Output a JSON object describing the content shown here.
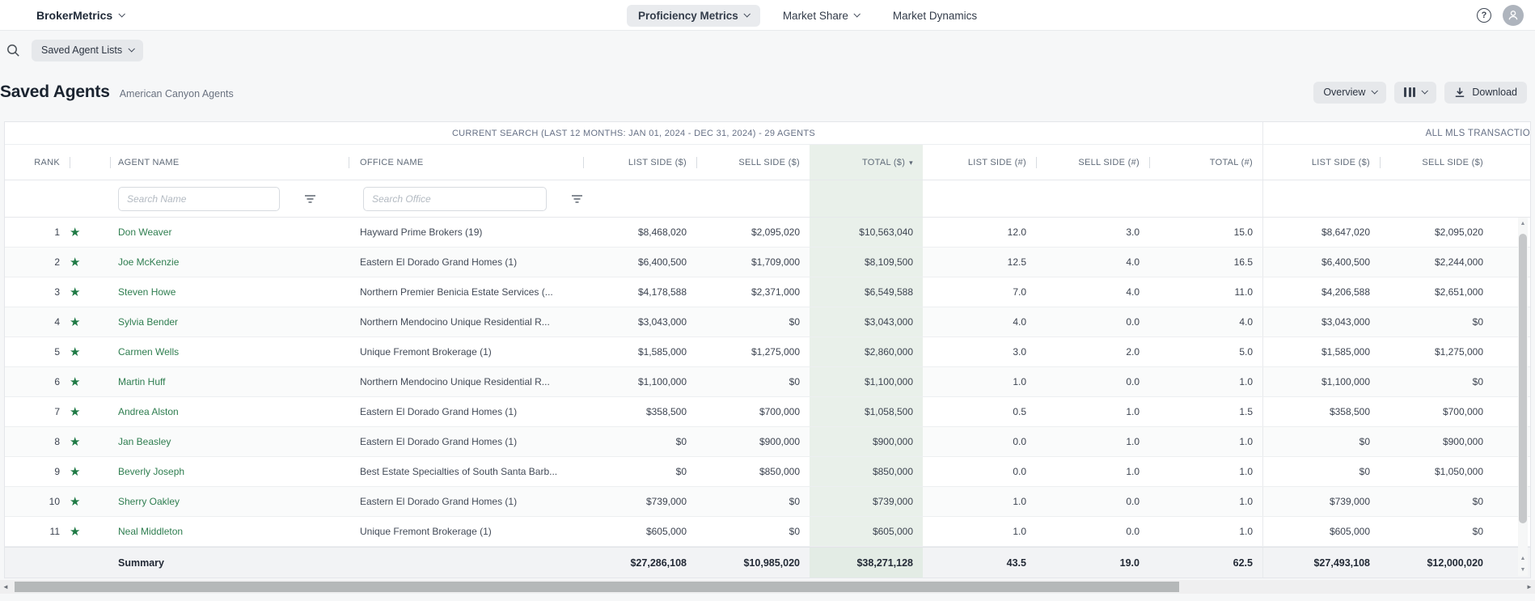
{
  "topnav": {
    "brand": "BrokerMetrics",
    "items": [
      {
        "label": "Proficiency Metrics"
      },
      {
        "label": "Market Share"
      },
      {
        "label": "Market Dynamics"
      }
    ]
  },
  "toolbar": {
    "saved_lists": "Saved Agent Lists"
  },
  "header": {
    "title": "Saved Agents",
    "subtitle": "American Canyon Agents",
    "overview": "Overview",
    "download": "Download"
  },
  "table": {
    "group_left": "CURRENT SEARCH (LAST 12 MONTHS: JAN 01, 2024 - DEC 31, 2024) - 29 AGENTS",
    "group_right": "ALL MLS TRANSACTIO",
    "columns": {
      "rank": "RANK",
      "agent": "AGENT NAME",
      "office": "OFFICE NAME",
      "list_amt": "LIST SIDE ($)",
      "sell_amt": "SELL SIDE ($)",
      "total_amt": "TOTAL ($)",
      "list_cnt": "LIST SIDE (#)",
      "sell_cnt": "SELL SIDE (#)",
      "total_cnt": "TOTAL (#)",
      "mls_list_amt": "LIST SIDE ($)",
      "mls_sell_amt": "SELL SIDE ($)"
    },
    "filters": {
      "name_placeholder": "Search Name",
      "office_placeholder": "Search Office"
    },
    "rows": [
      {
        "rank": "1",
        "name": "Don Weaver",
        "office": "Hayward Prime Brokers (19)",
        "list_amt": "$8,468,020",
        "sell_amt": "$2,095,020",
        "total_amt": "$10,563,040",
        "list_cnt": "12.0",
        "sell_cnt": "3.0",
        "total_cnt": "15.0",
        "mls_list_amt": "$8,647,020",
        "mls_sell_amt": "$2,095,020"
      },
      {
        "rank": "2",
        "name": "Joe McKenzie",
        "office": "Eastern El Dorado Grand Homes (1)",
        "list_amt": "$6,400,500",
        "sell_amt": "$1,709,000",
        "total_amt": "$8,109,500",
        "list_cnt": "12.5",
        "sell_cnt": "4.0",
        "total_cnt": "16.5",
        "mls_list_amt": "$6,400,500",
        "mls_sell_amt": "$2,244,000"
      },
      {
        "rank": "3",
        "name": "Steven Howe",
        "office": "Northern Premier Benicia Estate Services (...",
        "list_amt": "$4,178,588",
        "sell_amt": "$2,371,000",
        "total_amt": "$6,549,588",
        "list_cnt": "7.0",
        "sell_cnt": "4.0",
        "total_cnt": "11.0",
        "mls_list_amt": "$4,206,588",
        "mls_sell_amt": "$2,651,000"
      },
      {
        "rank": "4",
        "name": "Sylvia Bender",
        "office": "Northern Mendocino Unique Residential R...",
        "list_amt": "$3,043,000",
        "sell_amt": "$0",
        "total_amt": "$3,043,000",
        "list_cnt": "4.0",
        "sell_cnt": "0.0",
        "total_cnt": "4.0",
        "mls_list_amt": "$3,043,000",
        "mls_sell_amt": "$0"
      },
      {
        "rank": "5",
        "name": "Carmen Wells",
        "office": "Unique Fremont Brokerage (1)",
        "list_amt": "$1,585,000",
        "sell_amt": "$1,275,000",
        "total_amt": "$2,860,000",
        "list_cnt": "3.0",
        "sell_cnt": "2.0",
        "total_cnt": "5.0",
        "mls_list_amt": "$1,585,000",
        "mls_sell_amt": "$1,275,000"
      },
      {
        "rank": "6",
        "name": "Martin Huff",
        "office": "Northern Mendocino Unique Residential R...",
        "list_amt": "$1,100,000",
        "sell_amt": "$0",
        "total_amt": "$1,100,000",
        "list_cnt": "1.0",
        "sell_cnt": "0.0",
        "total_cnt": "1.0",
        "mls_list_amt": "$1,100,000",
        "mls_sell_amt": "$0"
      },
      {
        "rank": "7",
        "name": "Andrea Alston",
        "office": "Eastern El Dorado Grand Homes (1)",
        "list_amt": "$358,500",
        "sell_amt": "$700,000",
        "total_amt": "$1,058,500",
        "list_cnt": "0.5",
        "sell_cnt": "1.0",
        "total_cnt": "1.5",
        "mls_list_amt": "$358,500",
        "mls_sell_amt": "$700,000"
      },
      {
        "rank": "8",
        "name": "Jan Beasley",
        "office": "Eastern El Dorado Grand Homes (1)",
        "list_amt": "$0",
        "sell_amt": "$900,000",
        "total_amt": "$900,000",
        "list_cnt": "0.0",
        "sell_cnt": "1.0",
        "total_cnt": "1.0",
        "mls_list_amt": "$0",
        "mls_sell_amt": "$900,000"
      },
      {
        "rank": "9",
        "name": "Beverly Joseph",
        "office": "Best Estate Specialties of South Santa Barb...",
        "list_amt": "$0",
        "sell_amt": "$850,000",
        "total_amt": "$850,000",
        "list_cnt": "0.0",
        "sell_cnt": "1.0",
        "total_cnt": "1.0",
        "mls_list_amt": "$0",
        "mls_sell_amt": "$1,050,000"
      },
      {
        "rank": "10",
        "name": "Sherry Oakley",
        "office": "Eastern El Dorado Grand Homes (1)",
        "list_amt": "$739,000",
        "sell_amt": "$0",
        "total_amt": "$739,000",
        "list_cnt": "1.0",
        "sell_cnt": "0.0",
        "total_cnt": "1.0",
        "mls_list_amt": "$739,000",
        "mls_sell_amt": "$0"
      },
      {
        "rank": "11",
        "name": "Neal Middleton",
        "office": "Unique Fremont Brokerage (1)",
        "list_amt": "$605,000",
        "sell_amt": "$0",
        "total_amt": "$605,000",
        "list_cnt": "1.0",
        "sell_cnt": "0.0",
        "total_cnt": "1.0",
        "mls_list_amt": "$605,000",
        "mls_sell_amt": "$0"
      }
    ],
    "summary": {
      "label": "Summary",
      "list_amt": "$27,286,108",
      "sell_amt": "$10,985,020",
      "total_amt": "$38,271,128",
      "list_cnt": "43.5",
      "sell_cnt": "19.0",
      "total_cnt": "62.5",
      "mls_list_amt": "$27,493,108",
      "mls_sell_amt": "$12,000,020"
    }
  },
  "icons": {
    "star": "★",
    "sort_caret": "▾",
    "help": "?",
    "scroll_up": "▲",
    "scroll_down": "▼",
    "scroll_left": "◄",
    "scroll_right": "►"
  },
  "colors": {
    "accent_green": "#2E7D4F",
    "star_green": "#1F7A45",
    "total_column_bg": "#E9F0EA"
  }
}
